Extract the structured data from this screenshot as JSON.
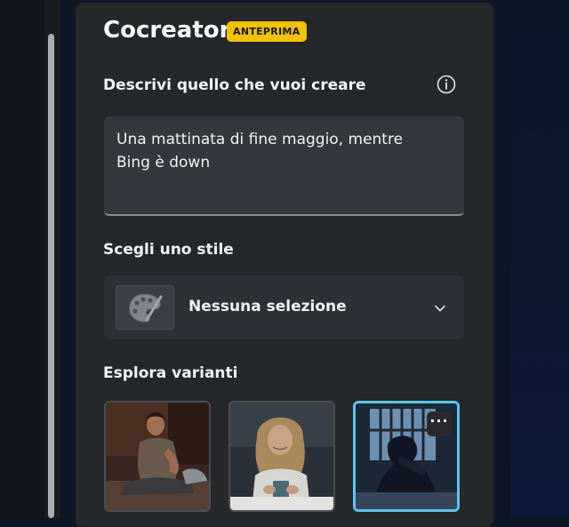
{
  "cocreator": {
    "title": "Cocreator",
    "badge": "ANTEPRIMA",
    "prompt_label": "Descrivi quello che vuoi creare",
    "prompt_text": "Una mattinata di fine maggio, mentre Bing è down",
    "style_label": "Scegli uno stile",
    "style_selected": "Nessuna selezione",
    "variants_label": "Esplora varianti",
    "variants": [
      {
        "name": "man-sitting-on-bed",
        "selected": false
      },
      {
        "name": "woman-with-mug",
        "selected": false
      },
      {
        "name": "person-head-in-hands",
        "selected": true
      }
    ],
    "more_button": "···"
  },
  "colors": {
    "panel": "#25272b",
    "badge": "#f2c200",
    "selection_border": "#5ec3e8"
  },
  "icons": [
    "info-icon",
    "palette-icon",
    "chevron-down-icon"
  ]
}
